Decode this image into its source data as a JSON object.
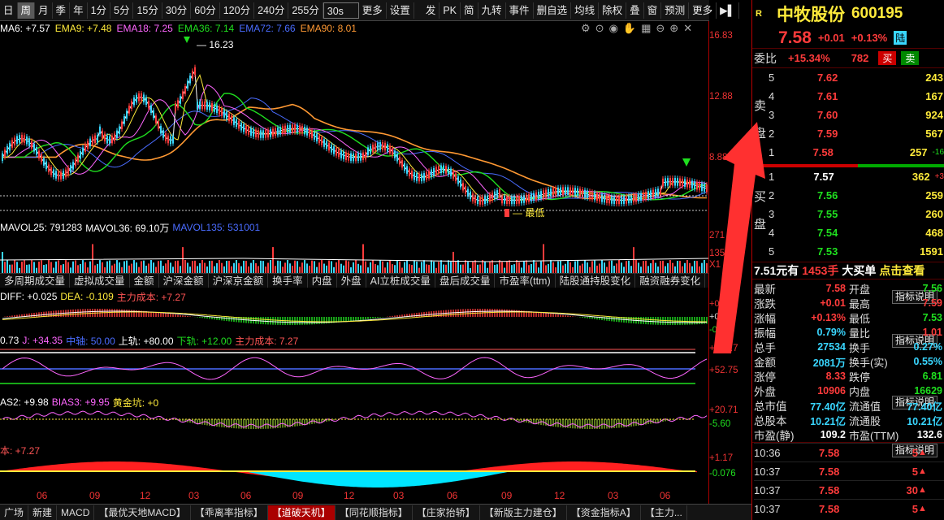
{
  "toolbar": {
    "items": [
      "日",
      "周",
      "月",
      "季",
      "年",
      "1分",
      "5分",
      "15分",
      "30分",
      "60分",
      "120分",
      "240分",
      "255分"
    ],
    "select": "30s",
    "more": "更多",
    "settings": "设置",
    "right": [
      "发",
      "PK",
      "简",
      "九转",
      "事件",
      "删自选",
      "均线",
      "除权",
      "叠",
      "窗",
      "预测",
      "更多"
    ]
  },
  "ma_legend": [
    {
      "text": "MA6: +7.57",
      "color": "#ffffff"
    },
    {
      "text": "EMA9: +7.48",
      "color": "#ffeb3b"
    },
    {
      "text": "EMA18: 7.25",
      "color": "#ff66ff"
    },
    {
      "text": "EMA36: 7.14",
      "color": "#1fe01f"
    },
    {
      "text": "EMA72: 7.66",
      "color": "#4a6cff"
    },
    {
      "text": "EMA90: 8.01",
      "color": "#ff9933"
    }
  ],
  "price_axis": [
    "16.83",
    "12.88",
    "8.88"
  ],
  "high_label": "16.23",
  "low_label": "最低",
  "vol_legend": [
    {
      "text": "MAVOL25: 791283",
      "color": "#ffffff"
    },
    {
      "text": "MAVOL36: 69.10万",
      "color": "#ffffff"
    },
    {
      "text": "MAVOL135: 531001",
      "color": "#4a6cff"
    }
  ],
  "vol_axis": [
    "271",
    "135",
    "X1"
  ],
  "tabs": [
    "多周期成交量",
    "虚拟成交量",
    "金额",
    "沪深金额",
    "沪深京金额",
    "换手率",
    "内盘",
    "外盘",
    "AI立桩成交量",
    "盘后成交量",
    "市盈率(ttm)",
    "陆股通持股变化",
    "融资融券变化"
  ],
  "macd_legend": [
    {
      "text": "DIFF: +0.025",
      "color": "#ffffff"
    },
    {
      "text": "DEA: -0.109",
      "color": "#ffeb3b"
    },
    {
      "text": "主力成本: +7.27",
      "color": "#ff5555"
    }
  ],
  "macd_axis": [
    "+0.308",
    "+0",
    "-0.328"
  ],
  "kdj_legend": [
    {
      "text": "0.73",
      "color": "#ffffff"
    },
    {
      "text": "J: +34.35",
      "color": "#ff66ff"
    },
    {
      "text": "中轴: 50.00",
      "color": "#4a6cff"
    },
    {
      "text": "上轨: +80.00",
      "color": "#ffffff"
    },
    {
      "text": "下轨: +12.00",
      "color": "#1fe01f"
    },
    {
      "text": "主力成本: 7.27",
      "color": "#ff5555"
    }
  ],
  "kdj_axis": [
    "+108.7",
    "+52.75"
  ],
  "bias_legend": [
    {
      "text": "AS2: +9.98",
      "color": "#ffffff"
    },
    {
      "text": "BIAS3: +9.95",
      "color": "#ff66ff"
    },
    {
      "text": "黄金坑: +0",
      "color": "#ffeb3b"
    }
  ],
  "bias_axis": [
    "+20.71",
    "-5.60"
  ],
  "cost_legend": [
    {
      "text": "本: +7.27",
      "color": "#ff5555"
    }
  ],
  "cost_axis": [
    "+1.17",
    "-0.076"
  ],
  "explain_label": "指标说明",
  "x_months": [
    "06",
    "09",
    "12",
    "03",
    "06",
    "09",
    "12",
    "03",
    "06",
    "09",
    "12",
    "03",
    "06"
  ],
  "bottom_tabs": [
    "广场",
    "新建",
    "MACD",
    "【最优天地MACD】",
    "【乖离率指标】",
    "【道破天机】",
    "【同花顺指标】",
    "【庄家抬轿】",
    "【新版主力建仓】",
    "【资金指标A】",
    "【主力..."
  ],
  "stock": {
    "badge": "R",
    "name": "中牧股份",
    "code": "600195",
    "price": "7.58",
    "change": "+0.01",
    "pct": "+0.13%",
    "tag": "陆"
  },
  "weibi": {
    "label": "委比",
    "pct": "+15.34%",
    "val": "782",
    "buy": "买",
    "sell": "卖"
  },
  "sell_label": "卖盘",
  "buy_label": "买盘",
  "asks": [
    {
      "n": "5",
      "p": "7.62",
      "v": "243",
      "c": "red"
    },
    {
      "n": "4",
      "p": "7.61",
      "v": "167",
      "c": "red"
    },
    {
      "n": "3",
      "p": "7.60",
      "v": "924",
      "c": "red"
    },
    {
      "n": "2",
      "p": "7.59",
      "v": "567",
      "c": "red"
    },
    {
      "n": "1",
      "p": "7.58",
      "v": "257",
      "c": "red",
      "d": "-16"
    }
  ],
  "bids": [
    {
      "n": "1",
      "p": "7.57",
      "v": "362",
      "c": "wht",
      "d": "+3"
    },
    {
      "n": "2",
      "p": "7.56",
      "v": "259",
      "c": "grn"
    },
    {
      "n": "3",
      "p": "7.55",
      "v": "260",
      "c": "grn"
    },
    {
      "n": "4",
      "p": "7.54",
      "v": "468",
      "c": "grn"
    },
    {
      "n": "5",
      "p": "7.53",
      "v": "1591",
      "c": "grn"
    }
  ],
  "bigorder": {
    "price": "7.51元有",
    "qty": "1453手",
    "text": "大买单",
    "link": "点击查看"
  },
  "quotes": [
    [
      "最新",
      "7.58",
      "red",
      "开盘",
      "7.56",
      "grn"
    ],
    [
      "涨跌",
      "+0.01",
      "red",
      "最高",
      "7.59",
      "red"
    ],
    [
      "涨幅",
      "+0.13%",
      "red",
      "最低",
      "7.53",
      "grn"
    ],
    [
      "振幅",
      "0.79%",
      "cyn",
      "量比",
      "1.01",
      "red"
    ],
    [
      "总手",
      "27534",
      "cyn",
      "换手",
      "0.27%",
      "cyn"
    ],
    [
      "金额",
      "2081万",
      "cyn",
      "换手(实)",
      "0.55%",
      "cyn"
    ],
    [
      "涨停",
      "8.33",
      "red",
      "跌停",
      "6.81",
      "grn"
    ],
    [
      "外盘",
      "10906",
      "red",
      "内盘",
      "16629",
      "grn"
    ],
    [
      "总市值",
      "77.40亿",
      "cyn",
      "流通值",
      "77.40亿",
      "cyn"
    ],
    [
      "总股本",
      "10.21亿",
      "cyn",
      "流通股",
      "10.21亿",
      "cyn"
    ],
    [
      "市盈(静)",
      "109.2",
      "wht",
      "市盈(TTM)",
      "132.6",
      "wht"
    ]
  ],
  "ticks": [
    {
      "t": "10:36",
      "p": "7.58",
      "v": "5"
    },
    {
      "t": "10:37",
      "p": "7.58",
      "v": "5"
    },
    {
      "t": "10:37",
      "p": "7.58",
      "v": "30"
    },
    {
      "t": "10:37",
      "p": "7.58",
      "v": "5"
    }
  ]
}
